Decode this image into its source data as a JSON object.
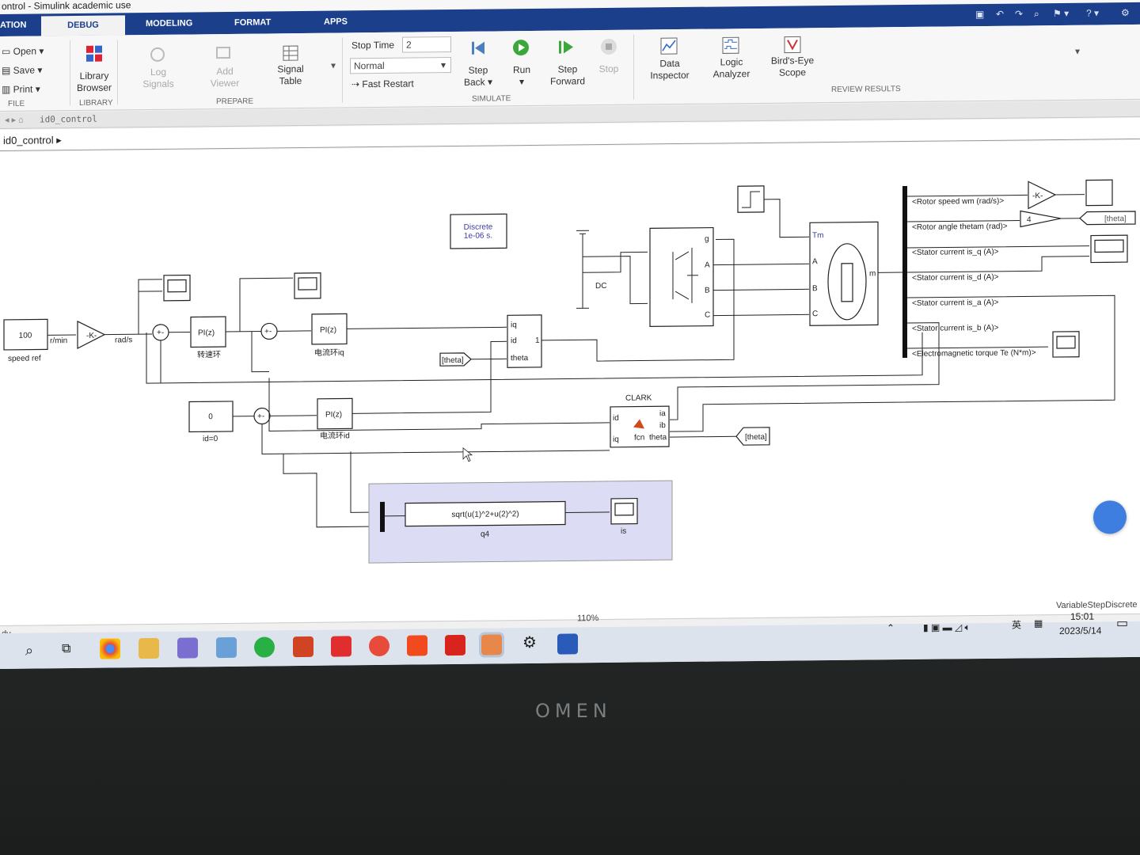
{
  "window": {
    "title": "ontrol - Simulink academic use"
  },
  "tabs": [
    "ATION",
    "DEBUG",
    "MODELING",
    "FORMAT",
    "APPS"
  ],
  "ribbon": {
    "file": {
      "open": "Open",
      "save": "Save",
      "print": "Print",
      "section": "FILE"
    },
    "library": {
      "button_line1": "Library",
      "button_line2": "Browser",
      "section": "LIBRARY"
    },
    "prepare": {
      "log_line1": "Log",
      "log_line2": "Signals",
      "add_line1": "Add",
      "add_line2": "Viewer",
      "signal_line1": "Signal",
      "signal_line2": "Table",
      "section": "PREPARE"
    },
    "simulate": {
      "stop_time_label": "Stop Time",
      "stop_time_value": "2",
      "mode_value": "Normal",
      "fast_restart": "Fast Restart",
      "step_back_line1": "Step",
      "step_back_line2": "Back",
      "run": "Run",
      "step_fwd_line1": "Step",
      "step_fwd_line2": "Forward",
      "stop": "Stop",
      "section": "SIMULATE"
    },
    "review": {
      "data_line1": "Data",
      "data_line2": "Inspector",
      "logic_line1": "Logic",
      "logic_line2": "Analyzer",
      "birds_line1": "Bird's-Eye",
      "birds_line2": "Scope",
      "section": "REVIEW RESULTS"
    }
  },
  "model_tab": "id0_control",
  "breadcrumb": "id0_control",
  "diagram": {
    "discrete_line1": "Discrete",
    "discrete_line2": "1e-06 s.",
    "speed_ref_value": "100",
    "speed_ref_label": "speed ref",
    "rpm_label": "r/min",
    "gain_label": "-K-",
    "rads_label": "rad/s",
    "pi_label": "PI(z)",
    "pi_speed_caption": "转速环",
    "pi_iq_caption": "电流环iq",
    "pi_id_caption": "电流环id",
    "id_ref_value": "0",
    "id_ref_label": "id=0",
    "dc_label": "DC",
    "theta_tag": "[theta]",
    "theta_goto": "[theta]",
    "invpark_ports": [
      "iq",
      "id",
      "theta"
    ],
    "invpark_out": "1",
    "clark_title": "CLARK",
    "clark_in_ports": [
      "ia",
      "ib",
      "theta"
    ],
    "clark_out_ports": [
      "id",
      "iq"
    ],
    "clark_fcn": "fcn",
    "bus_signals": [
      "<Rotor speed wm (rad/s)>",
      "<Rotor angle thetam (rad)>",
      "<Stator current is_q (A)>",
      "<Stator current is_d (A)>",
      "<Stator current is_a (A)>",
      "<Stator current is_b (A)>",
      "<Electromagnetic torque Te (N*m)>"
    ],
    "gain4": "4",
    "motor_tm": "Tm",
    "motor_m": "m",
    "motor_ports": [
      "A",
      "B",
      "C"
    ],
    "inverter_ports": [
      "g",
      "A",
      "B",
      "C"
    ],
    "fcn_expr": "sqrt(u(1)^2+u(2)^2)",
    "fcn_name": "q4",
    "scope_is": "is"
  },
  "status": {
    "zoom": "110%",
    "solver": "VariableStepDiscrete",
    "left": "dy"
  },
  "taskbar": {
    "lang": "英",
    "time": "15:01",
    "date": "2023/5/14"
  },
  "bezel_logo": "OMEN",
  "colors": {
    "tab_bar": "#1b3f8b",
    "run_green": "#3aa83a",
    "subsystem_fill": "#dcdcf4",
    "signal_label": "#3a3aa0"
  }
}
